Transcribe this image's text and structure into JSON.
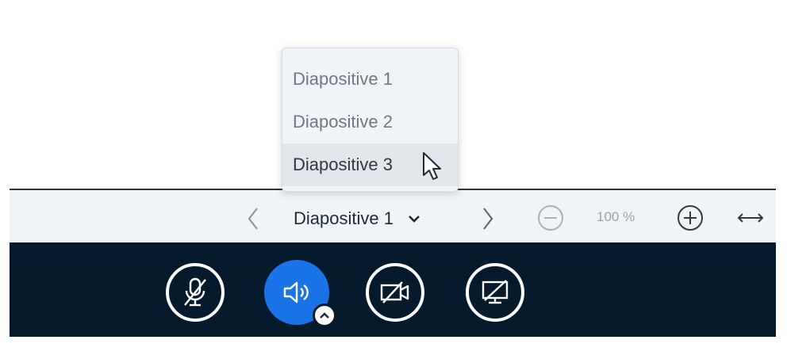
{
  "slide_nav": {
    "current_label": "Diapositive 1",
    "zoom_label": "100 %"
  },
  "dropdown": {
    "items": [
      "Diapositive 1",
      "Diapositive 2",
      "Diapositive 3"
    ],
    "hovered_index": 2
  },
  "icons": {
    "prev": "chevron-left-icon",
    "next": "chevron-right-icon",
    "select": "chevron-down-icon",
    "zoom_out": "zoom-out-icon",
    "zoom_in": "zoom-in-icon",
    "fit": "fit-width-icon",
    "mic": "mic-muted-icon",
    "audio": "speaker-icon",
    "camera": "camera-off-icon",
    "screen": "screen-share-off-icon",
    "cursor": "mouse-pointer-icon"
  },
  "colors": {
    "media_bar": "#061a2e",
    "accent": "#1b73e8",
    "toolbar": "#f1f4f7"
  }
}
